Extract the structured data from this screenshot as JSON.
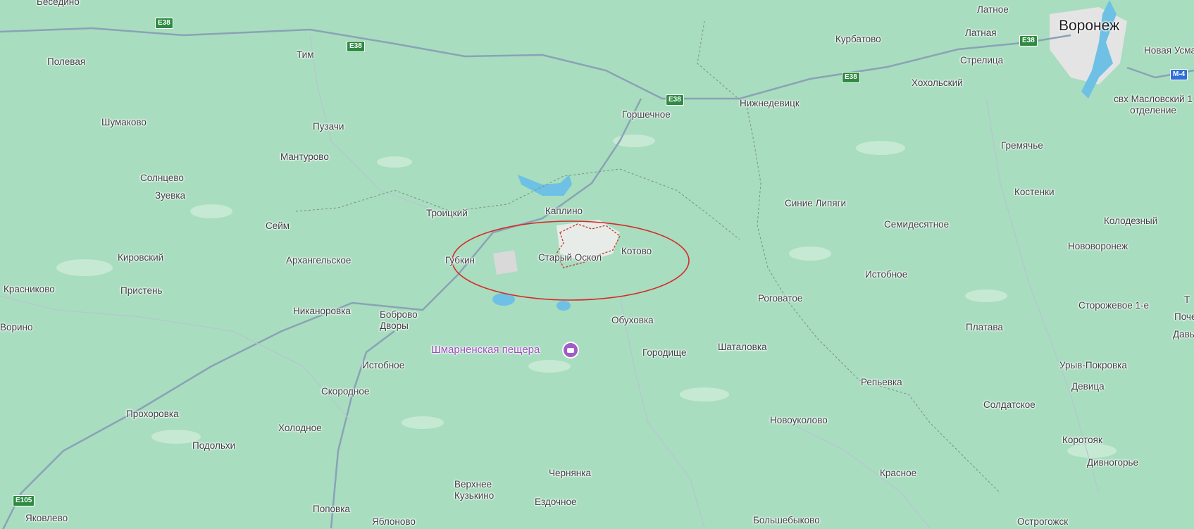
{
  "map": {
    "city_label": "Воронеж",
    "places": [
      "Беседино",
      "Полевая",
      "Тим",
      "Шумаково",
      "Пузачи",
      "Мантурово",
      "Солнцево",
      "Зуевка",
      "Сейм",
      "Кировский",
      "Архангельское",
      "Пристень",
      "Красниково",
      "Никаноровка",
      "Ворино",
      "Прохоровка",
      "Холодное",
      "Подольхи",
      "Яковлево",
      "Поповка",
      "Яблоново",
      "Верхнее Кузькино",
      "Чернянка",
      "Ездочное",
      "Скородное",
      "Истобное",
      "Боброво Дворы",
      "Губкин",
      "Троицкий",
      "Каплино",
      "Старый Оскол",
      "Котово",
      "Горшечное",
      "Обуховка",
      "Городище",
      "Шаталовка",
      "Роговатое",
      "Новоуколово",
      "Большебыково",
      "Красное",
      "Нижнедевицк",
      "Курбатово",
      "Латное",
      "Латная",
      "Стрелица",
      "Хохольский",
      "Синие Липяги",
      "Семидесятное",
      "Истобное",
      "Платава",
      "Репьевка",
      "Гремячье",
      "Костенки",
      "Колодезный",
      "Нововоронеж",
      "Сторожевое 1-е",
      "Урыв-Покровка",
      "Девица",
      "Солдатское",
      "Коротояк",
      "Дивногорье",
      "Острогожск",
      "Новая Усмань",
      "свх Масловский 1 отделение",
      "Давыдо",
      "Почепское",
      "Т"
    ],
    "poi_label": "Шмарненская пещера",
    "road_shields": [
      "E38",
      "E38",
      "E38",
      "E38",
      "E38",
      "E105",
      "M-4"
    ],
    "highlight_color": "#d62b2b",
    "poi_icon": "camera-icon"
  }
}
